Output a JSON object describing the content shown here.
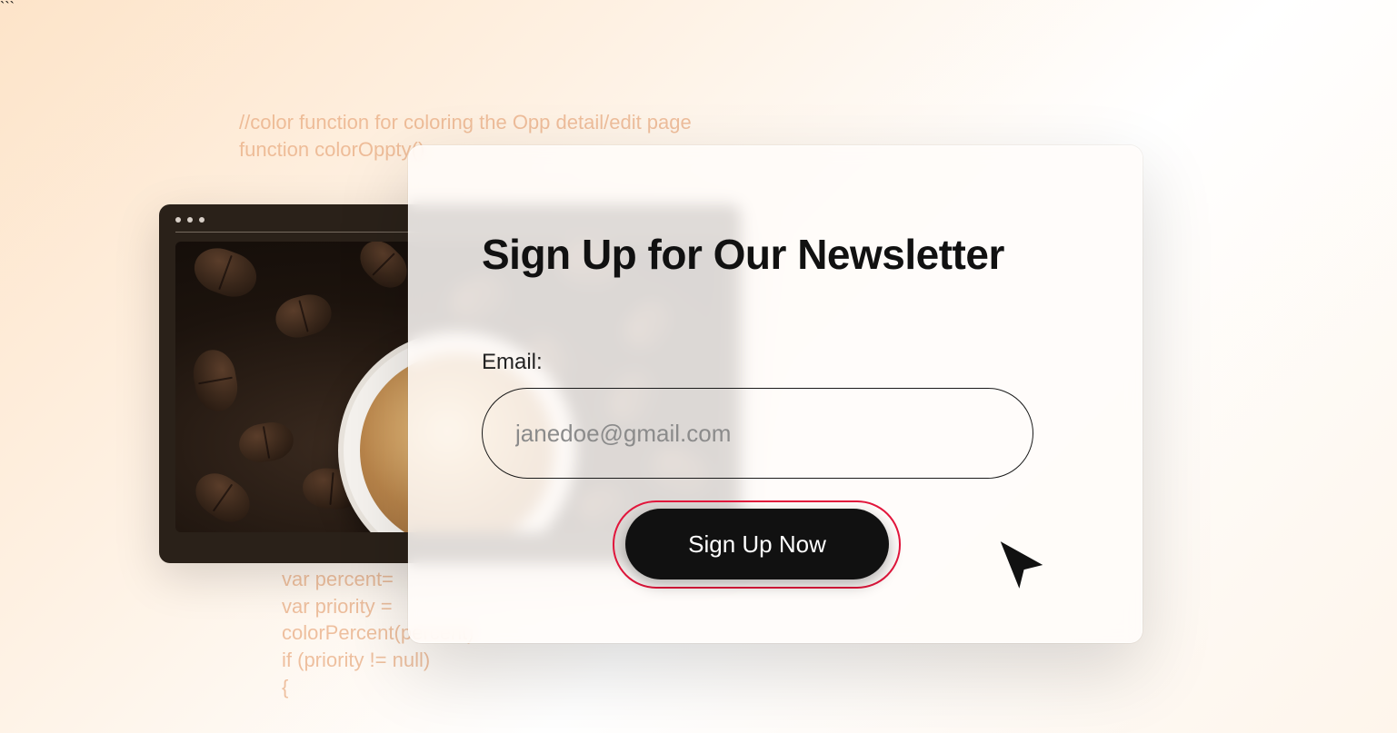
{
  "code_snippets": {
    "top": "//color function for coloring the Opp detail/edit page\nfunction colorOppty()",
    "bottom": "var percent=\nvar priority =\ncolorPercent(percent)\nif (priority != null)\n{"
  },
  "card": {
    "title": "Sign Up for Our Newsletter",
    "email_label": "Email:",
    "email_placeholder": "janedoe@gmail.com",
    "button_label": "Sign Up Now"
  }
}
